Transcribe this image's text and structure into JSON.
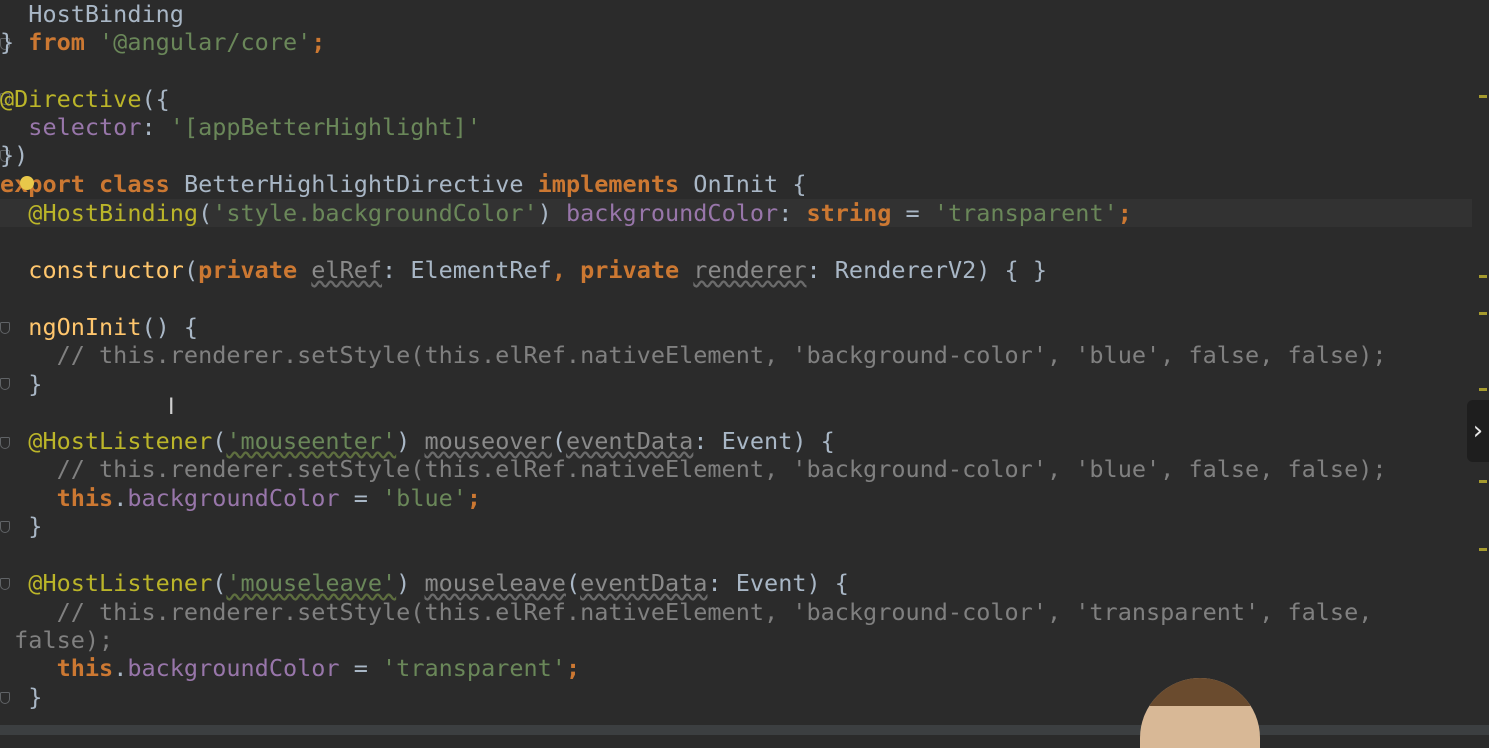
{
  "colors": {
    "background": "#2b2b2b",
    "keyword": "#cc7832",
    "annotation": "#bbb529",
    "string": "#6a8759",
    "comment": "#808080",
    "field": "#9876aa",
    "function": "#ffc66d",
    "plain": "#a9b7c6"
  },
  "icons": {
    "intention_bulb": "lightbulb-icon",
    "next_arrow": "chevron-right-icon",
    "text_cursor": "ibeam-cursor-icon"
  },
  "code": {
    "l1": "  HostBinding",
    "l2_a": "} ",
    "l2_b": "from",
    "l2_c": " '@angular/core'",
    "l2_d": ";",
    "l4_a": "@Directive",
    "l4_b": "({",
    "l5_a": "  ",
    "l5_b": "selector",
    "l5_c": ": ",
    "l5_d": "'[appBetterHighlight]'",
    "l6": "})",
    "l7_a": "export ",
    "l7_b": "class ",
    "l7_c": "BetterHighlightDirective ",
    "l7_d": "implements ",
    "l7_e": "OnInit {",
    "l8_a": "  ",
    "l8_b": "@HostBinding",
    "l8_c": "(",
    "l8_d": "'style.backgroundColor'",
    "l8_e": ") ",
    "l8_f": "backgroundColor",
    "l8_g": ": ",
    "l8_h": "string",
    "l8_i": " = ",
    "l8_j": "'transparent'",
    "l8_k": ";",
    "l10_a": "  ",
    "l10_b": "constructor",
    "l10_c": "(",
    "l10_d": "private ",
    "l10_e": "elRef",
    "l10_f": ": ElementRef",
    "l10_g": ", ",
    "l10_h": "private ",
    "l10_i": "renderer",
    "l10_j": ": RendererV2) { }",
    "l12_a": "  ",
    "l12_b": "ngOnInit",
    "l12_c": "() {",
    "l13": "    // this.renderer.setStyle(this.elRef.nativeElement, 'background-color', 'blue', false, false);",
    "l14": "  }",
    "l16_a": "  ",
    "l16_b": "@HostListener",
    "l16_c": "(",
    "l16_d": "'mouseenter'",
    "l16_e": ") ",
    "l16_f": "mouseover",
    "l16_g": "(",
    "l16_h": "eventData",
    "l16_i": ": Event) {",
    "l17": "    // this.renderer.setStyle(this.elRef.nativeElement, 'background-color', 'blue', false, false);",
    "l18_a": "    ",
    "l18_b": "this",
    "l18_c": ".",
    "l18_d": "backgroundColor",
    "l18_e": " = ",
    "l18_f": "'blue'",
    "l18_g": ";",
    "l19": "  }",
    "l21_a": "  ",
    "l21_b": "@HostListener",
    "l21_c": "(",
    "l21_d": "'mouseleave'",
    "l21_e": ") ",
    "l21_f": "mouseleave",
    "l21_g": "(",
    "l21_h": "eventData",
    "l21_i": ": Event) {",
    "l22": "    // this.renderer.setStyle(this.elRef.nativeElement, 'background-color', 'transparent', false,",
    "l23": " false);",
    "l24_a": "    ",
    "l24_b": "this",
    "l24_c": ".",
    "l24_d": "backgroundColor",
    "l24_e": " = ",
    "l24_f": "'transparent'",
    "l24_g": ";",
    "l25": "  }"
  }
}
